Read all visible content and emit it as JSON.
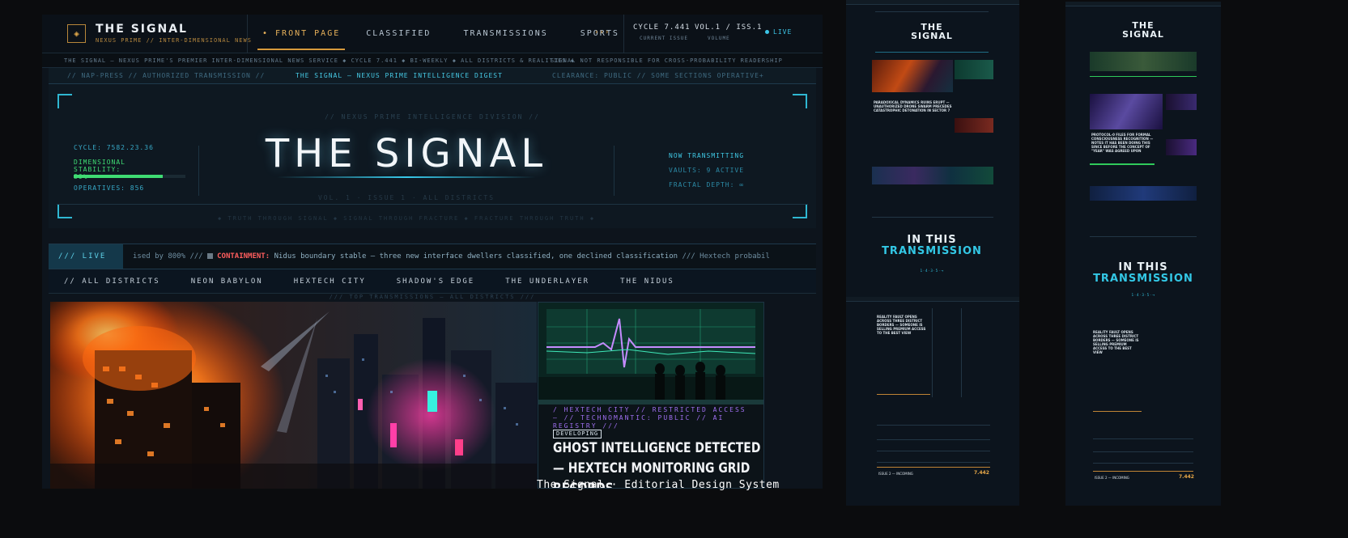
{
  "topbar": {
    "logo_icon": "◈",
    "brand": "THE SIGNAL",
    "brand_sub": "NEXUS PRIME // INTER-DIMENSIONAL NEWS",
    "tabs": [
      {
        "label": "• FRONT PAGE",
        "active": true
      },
      {
        "label": "CLASSIFIED",
        "active": false
      },
      {
        "label": "TRANSMISSIONS",
        "active": false
      },
      {
        "label": "SPORTS",
        "active": false
      }
    ],
    "more": "›››",
    "cycle": "CYCLE 7.441",
    "cycle_sub": "CURRENT ISSUE",
    "volume": "VOL.1 / ISS.1",
    "volume_sub": "VOLUME",
    "live": "LIVE"
  },
  "marquee": {
    "left": "THE SIGNAL — NEXUS PRIME'S PREMIER INTER-DIMENSIONAL NEWS SERVICE   ◆   CYCLE 7.441   ◆   BI-WEEKLY   ◆   ALL DISTRICTS & REALITIES   ◆",
    "right": "SIGNAL NOT RESPONSIBLE FOR CROSS-PROBABILITY READERSHIP"
  },
  "strip": {
    "left": "// NAP-PRESS // AUTHORIZED TRANSMISSION //",
    "center": "THE SIGNAL — NEXUS PRIME INTELLIGENCE DIGEST",
    "right": "CLEARANCE: PUBLIC // SOME SECTIONS OPERATIVE+"
  },
  "masthead": {
    "kicker": "// NEXUS PRIME INTELLIGENCE DIVISION //",
    "title": "THE SIGNAL",
    "vol_line": "VOL. 1  ·  ISSUE 1  ·  ALL DISTRICTS",
    "cycle": "CYCLE: 7582.23.36",
    "stability_label": "DIMENSIONAL STABILITY: 80%",
    "stability_value": 0.8,
    "operatives": "OPERATIVES: 856",
    "now_tx": "NOW TRANSMITTING",
    "vaults": "VAULTS: 9 ACTIVE",
    "fractal": "FRACTAL DEPTH: ∞",
    "tagline": "◆ TRUTH THROUGH SIGNAL ◆ SIGNAL THROUGH FRACTURE ◆ FRACTURE THROUGH TRUTH ◆"
  },
  "ticker": {
    "live": "/// LIVE ///",
    "pre": "ised by 800%   ///   ",
    "containment": "CONTAINMENT:",
    "body": " Nidus boundary stable — three new interface dwellers classified, one declined classification",
    "post": "   ///   Hextech probabil"
  },
  "districts": [
    "// ALL DISTRICTS",
    "NEON BABYLON",
    "HEXTECH CITY",
    "SHADOW'S EDGE",
    "THE UNDERLAYER",
    "THE NIDUS"
  ],
  "top_label": "/// TOP TRANSMISSIONS — ALL DISTRICTS ///",
  "feature": {
    "path": "/ HEXTECH CITY // RESTRICTED ACCESS — // TECHNOMANTIC: PUBLIC // AI REGISTRY ///",
    "badge": "DEVELOPING",
    "headline": "GHOST INTELLIGENCE DETECTED — HEXTECH MONITORING GRID RECORDS"
  },
  "caption": "The Signal · Editorial Design System",
  "thumb1": {
    "title_a": "THE",
    "title_b": "SIGNAL",
    "lead": "PARADOXICAL DYNAMICS RUINS ERUPT — UNAUTHORIZED DRONE SWARM PRECEDES CATASTROPHIC DETONATION IN SECTOR 7",
    "itt_a": "IN THIS",
    "itt_b": "TRANSMISSION",
    "pages": "1  ·  4  ·  3  ·  5  ·  →"
  },
  "thumb1b": {
    "story": "REALITY FAULT OPENS ACROSS THREE DISTRICT BORDERS — SOMEONE IS SELLING PREMIUM ACCESS TO THE BEST VIEW",
    "issue": "ISSUE 2 — INCOMING",
    "issue_num": "7.442"
  },
  "thumb2": {
    "title_a": "THE",
    "title_b": "SIGNAL",
    "lead": "PROTOCOL-0 FILES FOR FORMAL CONSCIOUSNESS RECOGNITION — NOTES IT HAS BEEN DOING THIS SINCE BEFORE THE CONCEPT OF \"YEAR\" WAS AGREED UPON",
    "itt_a": "IN THIS",
    "itt_b": "TRANSMISSION",
    "pages": "1  ·  4  ·  3  ·  5  ·  →",
    "story": "REALITY FAULT OPENS ACROSS THREE DISTRICT BORDERS — SOMEONE IS SELLING PREMIUM ACCESS TO THE BEST VIEW",
    "issue": "ISSUE 2 — INCOMING",
    "issue_num": "7.442"
  },
  "colors": {
    "accent_gold": "#d79a3c",
    "accent_cyan": "#33c8e6",
    "alert_red": "#ff5e5e",
    "stability_green": "#3fdc73",
    "violet": "#9f6ff0"
  }
}
